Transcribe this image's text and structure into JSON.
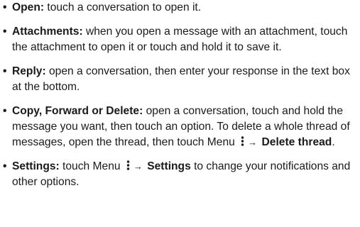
{
  "items": [
    {
      "term": "Open:",
      "text": " touch a conversation to open it."
    },
    {
      "term": "Attachments:",
      "text": " when you open a message with an attachment, touch the attachment to open it or touch and hold it to save it."
    },
    {
      "term": "Reply:",
      "text": " open a conversation, then enter your response in the text box at the bottom."
    },
    {
      "term": "Copy, Forward or Delete:",
      "text": " open a conversation, touch and hold the message you want, then touch an option. To delete a whole thread of messages, open the thread, then touch Menu",
      "arrow": "→",
      "action": "Delete thread",
      "end": "."
    },
    {
      "term": "Settings:",
      "text_before": " touch Menu",
      "arrow": "→",
      "action": "Settings",
      "text_after": " to change your notifications and other options."
    }
  ],
  "icons": {
    "menu": "vertical-dots-menu-icon"
  }
}
